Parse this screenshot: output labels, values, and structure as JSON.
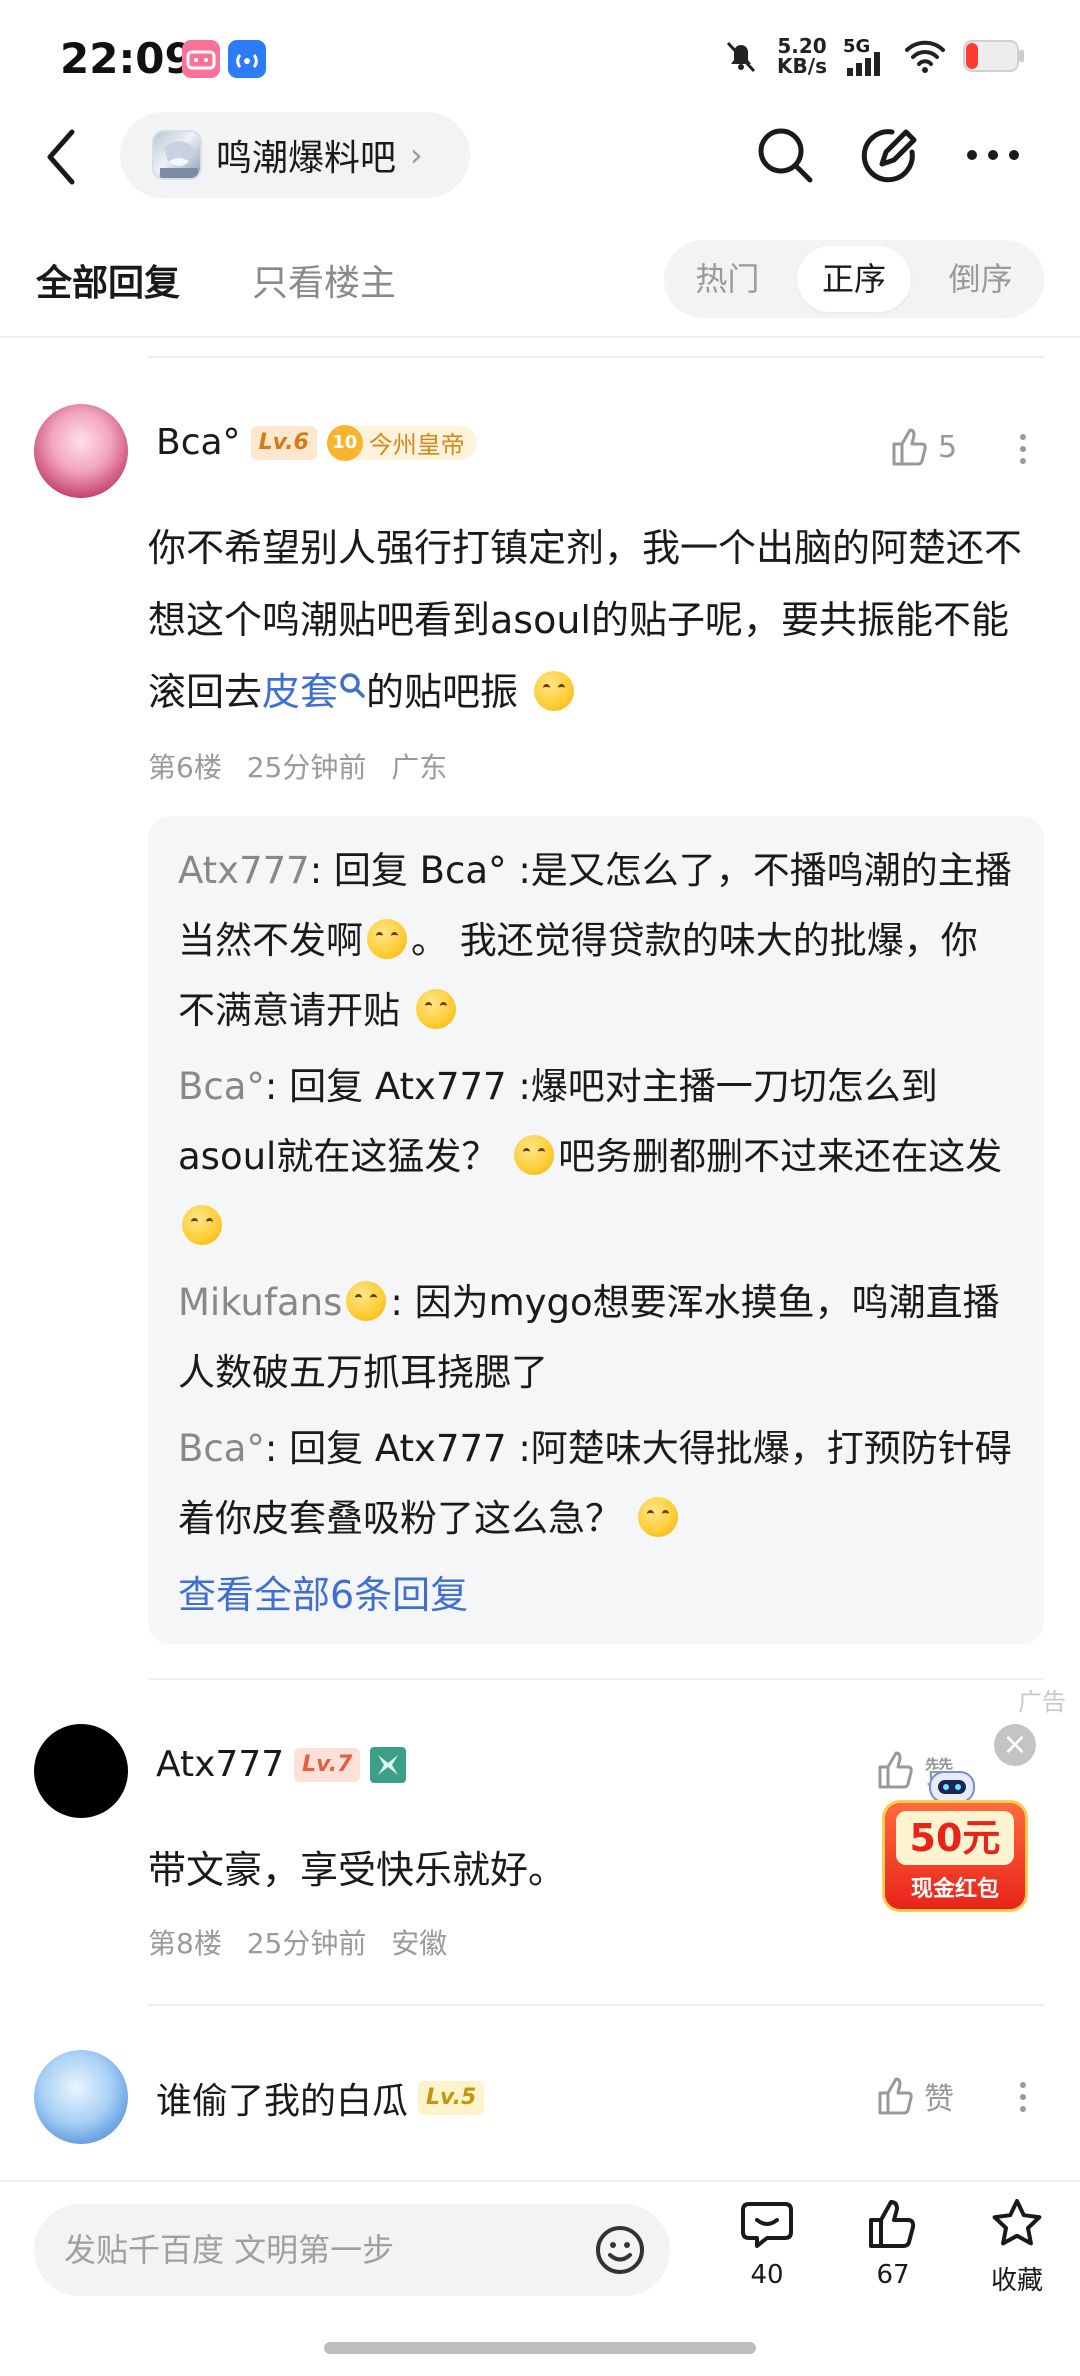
{
  "status": {
    "time": "22:09",
    "net_speed_value": "5.20",
    "net_speed_unit": "KB/s",
    "network": "5G"
  },
  "header": {
    "forum_name": "鸣潮爆料吧",
    "chevron": "›"
  },
  "tabs": {
    "all_replies": "全部回复",
    "op_only": "只看楼主",
    "sort": [
      "热门",
      "正序",
      "倒序"
    ],
    "sort_selected": "正序"
  },
  "comments": [
    {
      "user": "Bca°",
      "level": "Lv.6",
      "badge_num": "10",
      "badge_title": "今州皇帝",
      "likes": "5",
      "text_before_link": "你不希望别人强行打镇定剂，我一个出脑的阿楚还不想这个鸣潮贴吧看到asoul的贴子呢，要共振能不能滚回去",
      "link_text": "皮套",
      "text_after_link": "的贴吧振",
      "floor": "第6楼",
      "time": "25分钟前",
      "location": "广东",
      "replies": [
        {
          "who": "Atx777",
          "text": ": 回复 Bca° :是又怎么了，不播鸣潮的主播当然不发啊",
          "text2": "。 我还觉得贷款的味大的批爆，你不满意请开贴"
        },
        {
          "who": "Bca°",
          "text": ": 回复 Atx777 :爆吧对主播一刀切怎么到asoul就在这猛发？",
          "text2": "吧务删都删不过来还在这发"
        },
        {
          "who": "Mikufans",
          "text": ": 因为mygo想要浑水摸鱼，鸣潮直播人数破五万抓耳挠腮了",
          "text2": ""
        },
        {
          "who": "Bca°",
          "text": ": 回复 Atx777 :阿楚味大得批爆，打预防针碍着你皮套叠吸粉了这么急？",
          "text2": ""
        }
      ],
      "view_all": "查看全部6条回复"
    },
    {
      "user": "Atx777",
      "level": "Lv.7",
      "like_label": "赞",
      "text": "带文豪，享受快乐就好。",
      "floor": "第8楼",
      "time": "25分钟前",
      "location": "安徽"
    },
    {
      "user": "谁偷了我的白瓜",
      "level": "Lv.5",
      "like_label": "赞"
    }
  ],
  "ad": {
    "tag": "广告",
    "close": "×",
    "amount": "50元",
    "label": "现金红包"
  },
  "bottom": {
    "input_placeholder": "发贴千百度 文明第一步",
    "comments_count": "40",
    "likes_count": "67",
    "favorite_label": "收藏"
  },
  "icons": {
    "back": "back-arrow-icon",
    "search": "search-icon",
    "edit": "edit-icon",
    "more": "more-icon",
    "like": "thumb-up-icon",
    "emoji": "emoji-icon",
    "comment": "comment-icon",
    "star": "star-icon"
  },
  "colors": {
    "link_blue": "#3f6fd1",
    "level_bg": "#fde8cf",
    "level_text": "#d57a1b",
    "reply_bg": "#f5f6f8",
    "ad_red": "#f03a2a"
  }
}
